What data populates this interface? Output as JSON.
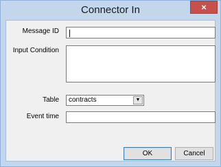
{
  "window": {
    "title": "Connector In",
    "close_glyph": "×"
  },
  "form": {
    "message_id_label": "Message ID",
    "message_id_value": "",
    "input_condition_label": "Input Condition",
    "input_condition_value": "",
    "table_label": "Table",
    "table_value": "contracts",
    "event_time_label": "Event time",
    "event_time_value": ""
  },
  "buttons": {
    "ok_label": "OK",
    "cancel_label": "Cancel"
  },
  "icons": {
    "close": "close-icon",
    "dropdown": "chevron-down-icon"
  }
}
